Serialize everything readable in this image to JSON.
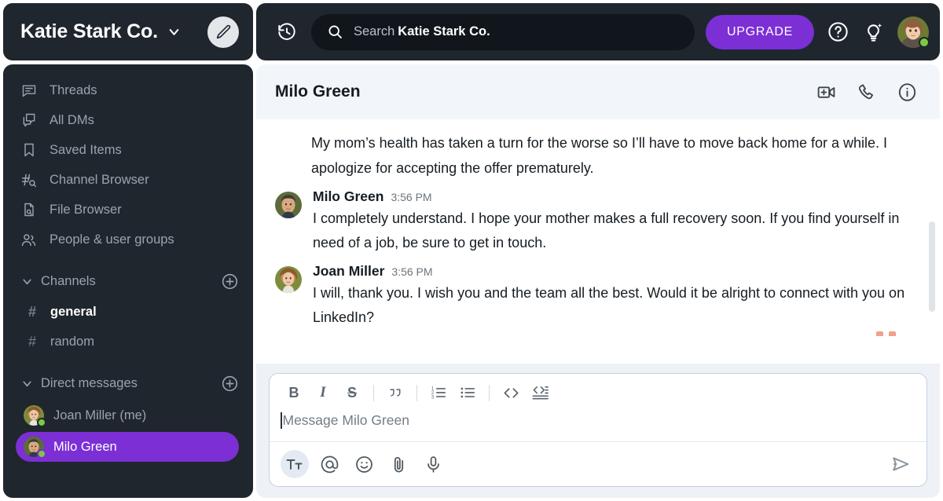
{
  "workspace": {
    "name": "Katie Stark Co.",
    "chevron_icon": "chevron-down-icon",
    "compose_icon": "pencil-icon"
  },
  "sidebar": {
    "nav_items": [
      {
        "label": "Threads",
        "icon": "threads-icon"
      },
      {
        "label": "All DMs",
        "icon": "all-dms-icon"
      },
      {
        "label": "Saved Items",
        "icon": "bookmark-icon"
      },
      {
        "label": "Channel Browser",
        "icon": "channel-browser-icon"
      },
      {
        "label": "File Browser",
        "icon": "file-browser-icon"
      },
      {
        "label": "People & user groups",
        "icon": "people-icon"
      }
    ],
    "channels_section": {
      "label": "Channels",
      "add_icon": "plus-circle-icon",
      "chevron_icon": "chevron-down-icon",
      "items": [
        {
          "name": "general",
          "prefix": "#",
          "active": true
        },
        {
          "name": "random",
          "prefix": "#",
          "active": false
        }
      ]
    },
    "dms_section": {
      "label": "Direct messages",
      "add_icon": "plus-circle-icon",
      "chevron_icon": "chevron-down-icon",
      "items": [
        {
          "name": "Joan Miller (me)",
          "presence": "online",
          "selected": false
        },
        {
          "name": "Milo Green",
          "presence": "online",
          "selected": true
        }
      ]
    }
  },
  "topbar": {
    "history_icon": "history-clock-icon",
    "search": {
      "icon": "search-icon",
      "label": "Search",
      "scope": "Katie Stark Co."
    },
    "upgrade_label": "UPGRADE",
    "help_icon": "question-circle-icon",
    "ideas_icon": "lightbulb-sparkle-icon",
    "avatar_name": "user-avatar",
    "presence": "online"
  },
  "conversation": {
    "title": "Milo Green",
    "actions": [
      {
        "icon": "video-call-icon"
      },
      {
        "icon": "phone-call-icon"
      },
      {
        "icon": "info-circle-icon"
      }
    ],
    "continued_text": "My mom’s health has taken a turn for the worse so I’ll have to move back home for a while. I apologize for accepting the offer prematurely.",
    "messages": [
      {
        "author": "Milo Green",
        "time": "3:56 PM",
        "text": "I completely understand. I hope your mother makes a full recovery soon. If you find yourself in need of a job, be sure to get in touch."
      },
      {
        "author": "Joan Miller",
        "time": "3:56 PM",
        "text": "I will, thank you. I wish you and the team all the best. Would it be alright to connect with you on LinkedIn?"
      }
    ]
  },
  "composer": {
    "format_buttons": [
      {
        "name": "bold",
        "glyph": "B"
      },
      {
        "name": "italic",
        "glyph": "I"
      },
      {
        "name": "strikethrough",
        "glyph": "S"
      },
      {
        "name": "blockquote",
        "glyph": ""
      },
      {
        "name": "ordered-list",
        "glyph": ""
      },
      {
        "name": "bulleted-list",
        "glyph": ""
      },
      {
        "name": "code",
        "glyph": ""
      },
      {
        "name": "code-block",
        "glyph": ""
      }
    ],
    "placeholder": "Message Milo Green",
    "footer_buttons": [
      {
        "name": "formatting",
        "label": "Tt",
        "active": true
      },
      {
        "name": "mention",
        "label": "@",
        "active": false
      },
      {
        "name": "emoji",
        "label": "",
        "active": false
      },
      {
        "name": "attachment",
        "label": "",
        "active": false
      },
      {
        "name": "audio",
        "label": "",
        "active": false
      }
    ],
    "send_icon": "send-icon"
  },
  "colors": {
    "sidebar_bg": "#1f262e",
    "accent_purple": "#7b2fd4",
    "presence_green": "#7ec93f",
    "header_bg": "#f2f6fa",
    "composer_bg": "#eef2f7"
  }
}
